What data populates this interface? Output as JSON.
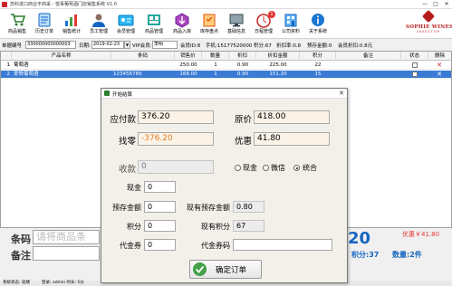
{
  "window": {
    "title": "苏科进口商业平商采 - 悦事葡萄酒门店销售系统 V1.0",
    "minimize": "—",
    "maximize": "□",
    "close": "✕"
  },
  "toolbar": {
    "items": [
      {
        "label": "商品销售",
        "icon": "cart-icon",
        "color": "#2e7d32"
      },
      {
        "label": "历史订单",
        "icon": "history-icon",
        "color": "#1565c0"
      },
      {
        "label": "销售统计",
        "icon": "stats-icon",
        "color": "#1976d2"
      },
      {
        "label": "员工管理",
        "icon": "staff-icon",
        "color": "#5d4037"
      },
      {
        "label": "会员管理",
        "icon": "member-icon",
        "color": "#0277bd"
      },
      {
        "label": "商品管理",
        "icon": "goods-icon",
        "color": "#00897b"
      },
      {
        "label": "商品入库",
        "icon": "stock-in-icon",
        "color": "#6a1b9a"
      },
      {
        "label": "库存盘点",
        "icon": "inventory-icon",
        "color": "#e65100"
      },
      {
        "label": "基础信息",
        "icon": "base-info-icon",
        "color": "#37474f"
      },
      {
        "label": "日程管理",
        "icon": "calendar-icon",
        "color": "#c62828"
      },
      {
        "label": "公司资料",
        "icon": "company-icon",
        "color": "#1565c0"
      },
      {
        "label": "关于系统",
        "icon": "about-icon",
        "color": "#1976d2"
      }
    ],
    "schedule_badge": "1"
  },
  "logo": {
    "brand": "SOPHIE WINES",
    "sub": "INVESTOR"
  },
  "infobar": {
    "order_no_label": "单据编号",
    "order_no": "330000000000003",
    "date_label": "日期:",
    "date": "2019-02-23",
    "vip_label": "VIP会员:",
    "vip": "李明",
    "member_id": "会员ID:8",
    "phone": "手机:15177520000",
    "points": "积分:67",
    "discount": "折扣率:0.8",
    "pre_amount": "预存金额:0",
    "member_discount": "会员折扣:0.8元"
  },
  "table": {
    "columns": [
      "产品名称",
      "条码",
      "销售价",
      "数量",
      "折扣",
      "折扣金额",
      "积分",
      "备注",
      "状态",
      "删除"
    ],
    "rows": [
      {
        "num": "1",
        "name": "葡萄酒",
        "barcode": "",
        "price": "250.00",
        "qty": "1",
        "discount": "0.90",
        "disc_amount": "225.00",
        "points": "22",
        "note": "",
        "selected": false
      },
      {
        "num": "2",
        "name": "爱情葡萄酒",
        "barcode": "123456789",
        "price": "168.00",
        "qty": "1",
        "discount": "0.90",
        "disc_amount": "151.20",
        "points": "15",
        "note": "",
        "selected": true
      }
    ]
  },
  "bottom": {
    "barcode_label": "条码",
    "barcode_placeholder": "请将商品条",
    "remark_label": "备注",
    "total": "20",
    "discount_amount": "优惠￥41.80",
    "points": "积分:37",
    "count": "数量:2件"
  },
  "status": {
    "left": "系统状态: 就绪",
    "user": "登录: admin 时长: 5分"
  },
  "dialog": {
    "title": "开始结算",
    "receivable_label": "应付款",
    "receivable": "376.20",
    "original_label": "原价",
    "original": "418.00",
    "change_label": "找零",
    "change": "-376.20",
    "discount_label": "优惠",
    "discount": "41.80",
    "paid_label": "收款",
    "paid": "0",
    "pay_methods": [
      {
        "label": "现金",
        "checked": false
      },
      {
        "label": "微信",
        "checked": false
      },
      {
        "label": "统合",
        "checked": true
      }
    ],
    "cash_label": "现金",
    "cash": "0",
    "prestored_label": "预存金额",
    "prestored": "0",
    "current_prestored_label": "现有预存金额",
    "current_prestored": "0.80",
    "points_label": "积分",
    "points": "0",
    "current_points_label": "现有积分",
    "current_points": "67",
    "coupon_label": "代金券",
    "coupon": "0",
    "coupon_code_label": "代金券码",
    "coupon_code": "",
    "confirm_label": "确定订单"
  }
}
